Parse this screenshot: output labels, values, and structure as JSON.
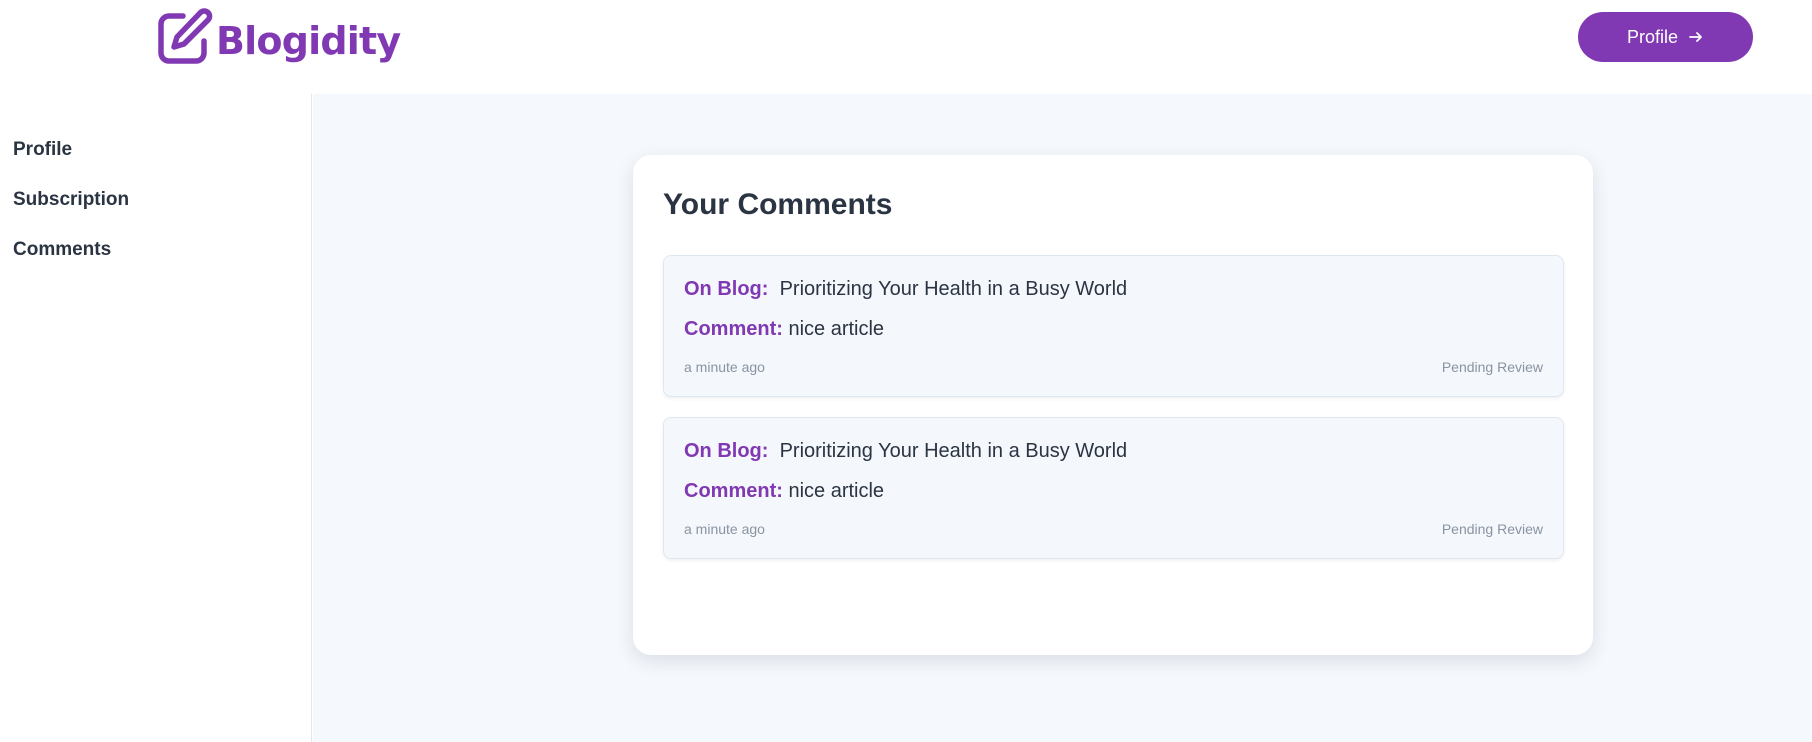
{
  "header": {
    "logo_text": "Blogidity",
    "profile_button_label": "Profile"
  },
  "sidebar": {
    "items": [
      {
        "label": "Profile"
      },
      {
        "label": "Subscription"
      },
      {
        "label": "Comments"
      }
    ]
  },
  "main": {
    "title": "Your Comments",
    "comments": [
      {
        "blog_label": "On Blog:",
        "blog_title": "Prioritizing Your Health in a Busy World",
        "comment_label": "Comment:",
        "comment_text": "nice article",
        "time": "a minute ago",
        "status": "Pending Review"
      },
      {
        "blog_label": "On Blog:",
        "blog_title": "Prioritizing Your Health in a Busy World",
        "comment_label": "Comment:",
        "comment_text": "nice article",
        "time": "a minute ago",
        "status": "Pending Review"
      }
    ]
  },
  "colors": {
    "brand": "#8139b3",
    "text": "#2b3442",
    "muted": "#8a93a2",
    "main_bg": "#f5f8fc"
  },
  "icons": {
    "logo": "edit-square-icon",
    "profile_button": "arrow-right-icon"
  }
}
